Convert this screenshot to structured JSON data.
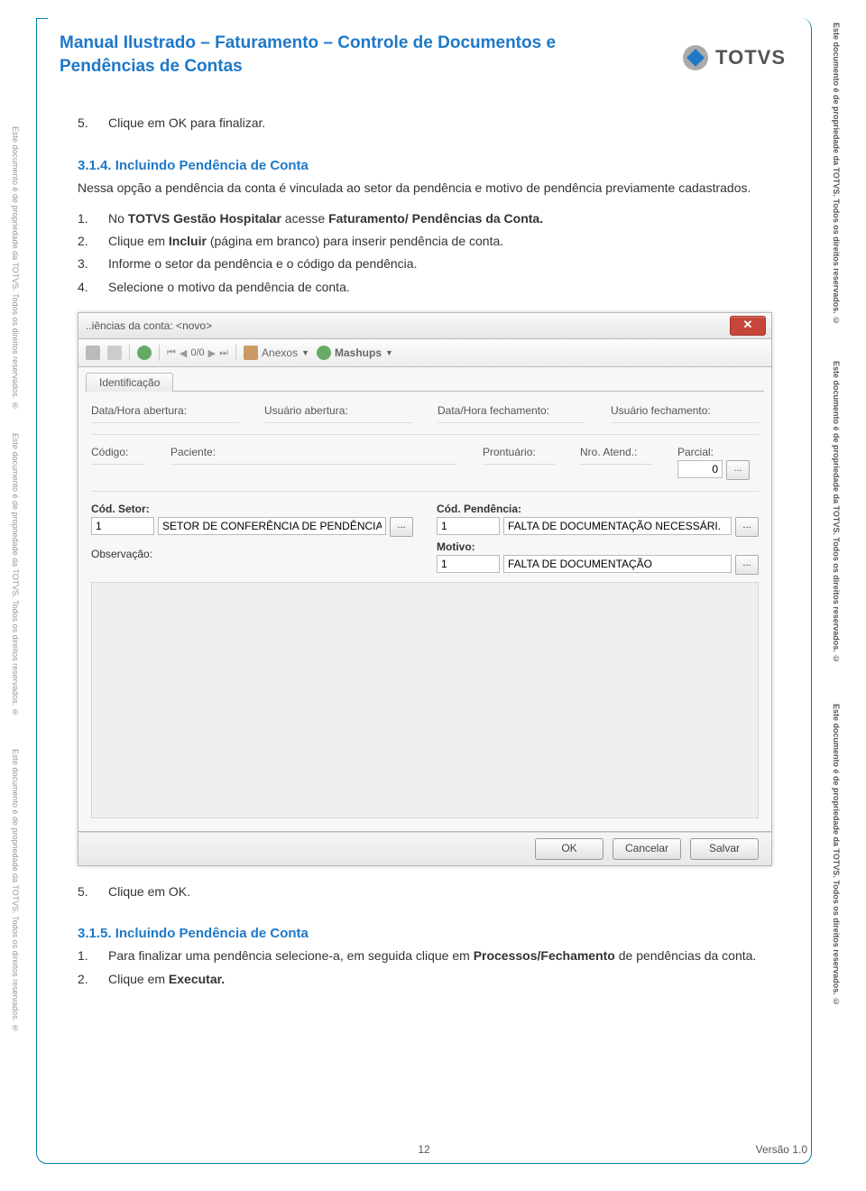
{
  "side_text_left": "Este documento é de propriedade da TOTVS. Todos os direitos reservados. ®",
  "side_text_right": "Este documento é de propriedade da TOTVS. Todos os direitos reservados. ©",
  "header": {
    "title_line1": "Manual Ilustrado – Faturamento – Controle de Documentos e",
    "title_line2": "Pendências de Contas"
  },
  "logo_text": "TOTVS",
  "body": {
    "step5_top_num": "5.",
    "step5_top_text": "Clique em OK para finalizar.",
    "sec314": "3.1.4. Incluindo Pendência de Conta",
    "sec314_intro": "Nessa opção a pendência da conta é vinculada ao setor da pendência e motivo de pendência previamente cadastrados.",
    "step1_num": "1.",
    "step1_text_a": "No ",
    "step1_text_b": "TOTVS Gestão Hospitalar",
    "step1_text_c": "  acesse ",
    "step1_text_d": "Faturamento/ Pendências da Conta.",
    "step2_num": "2.",
    "step2_text_a": "Clique em ",
    "step2_text_b": "Incluir",
    "step2_text_c": " (página em branco) para inserir pendência de conta.",
    "step3_num": "3.",
    "step3_text": "Informe o setor da pendência e o código da pendência.",
    "step4_num": "4.",
    "step4_text": "Selecione o motivo da pendência de conta.",
    "step5b_num": "5.",
    "step5b_text": "Clique em OK.",
    "sec315": "3.1.5. Incluindo Pendência de Conta",
    "step315_1_num": "1.",
    "step315_1_text_a": "Para finalizar uma pendência selecione-a, em seguida clique em ",
    "step315_1_text_b": "Processos/Fechamento",
    "step315_1_text_c": " de pendências da conta.",
    "step315_2_num": "2.",
    "step315_2_text_a": "Clique em ",
    "step315_2_text_b": "Executar."
  },
  "dialog": {
    "title": "..iências da conta: <novo>",
    "pager": "0/0",
    "anexos": "Anexos",
    "mashups": "Mashups",
    "tab_ident": "Identificação",
    "labels": {
      "data_abertura": "Data/Hora abertura:",
      "usuario_abertura": "Usuário abertura:",
      "data_fechamento": "Data/Hora fechamento:",
      "usuario_fechamento": "Usuário fechamento:",
      "codigo": "Código:",
      "paciente": "Paciente:",
      "prontuario": "Prontuário:",
      "nro_atend": "Nro. Atend.:",
      "parcial": "Parcial:",
      "cod_setor": "Cód. Setor:",
      "cod_pendencia": "Cód. Pendência:",
      "motivo": "Motivo:",
      "observacao": "Observação:"
    },
    "values": {
      "parcial": "0",
      "cod_setor": "1",
      "setor_desc": "SETOR DE CONFERÊNCIA DE PENDÊNCIA",
      "cod_pend": "1",
      "pend_desc": "FALTA DE DOCUMENTAÇÃO NECESSÁRI.",
      "motivo_cod": "1",
      "motivo_desc": "FALTA DE DOCUMENTAÇÃO"
    },
    "buttons": {
      "ok": "OK",
      "cancel": "Cancelar",
      "save": "Salvar"
    }
  },
  "footer": {
    "page": "12",
    "version": "Versão 1.0"
  }
}
